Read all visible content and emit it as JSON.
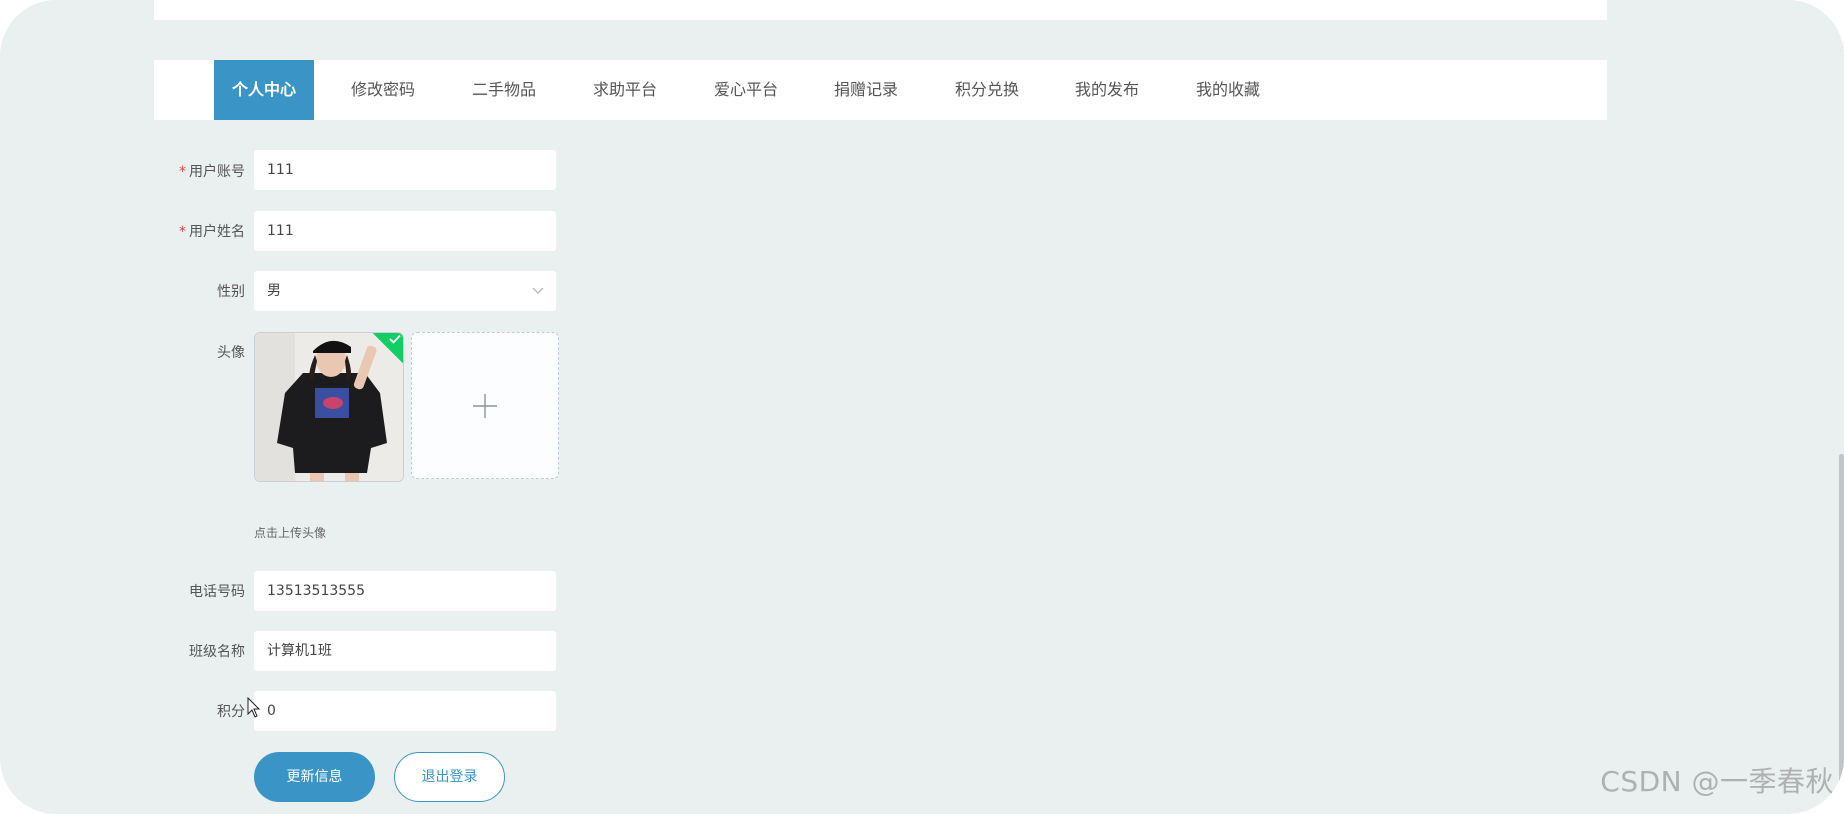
{
  "colors": {
    "accent": "#3a95c6",
    "background": "#eaeff0",
    "required": "#e04545",
    "success": "#13ce66"
  },
  "nav": {
    "items": [
      {
        "label": "个人中心",
        "active": true
      },
      {
        "label": "修改密码",
        "active": false
      },
      {
        "label": "二手物品",
        "active": false
      },
      {
        "label": "求助平台",
        "active": false
      },
      {
        "label": "爱心平台",
        "active": false
      },
      {
        "label": "捐赠记录",
        "active": false
      },
      {
        "label": "积分兑换",
        "active": false
      },
      {
        "label": "我的发布",
        "active": false
      },
      {
        "label": "我的收藏",
        "active": false
      }
    ]
  },
  "form": {
    "account": {
      "required_mark": "*",
      "label": "用户账号",
      "value": "111"
    },
    "name": {
      "required_mark": "*",
      "label": "用户姓名",
      "value": "111"
    },
    "gender": {
      "label": "性别",
      "value": "男",
      "icon": "chevron-down-icon"
    },
    "avatar": {
      "label": "头像",
      "hint": "点击上传头像",
      "upload_icon": "plus-icon",
      "status_icon": "check-icon"
    },
    "phone": {
      "label": "电话号码",
      "value": "13513513555"
    },
    "class_name": {
      "label": "班级名称",
      "value": "计算机1班"
    },
    "points": {
      "label": "积分",
      "value": "0"
    }
  },
  "buttons": {
    "update": "更新信息",
    "logout": "退出登录"
  },
  "watermark": "CSDN @一季春秋"
}
